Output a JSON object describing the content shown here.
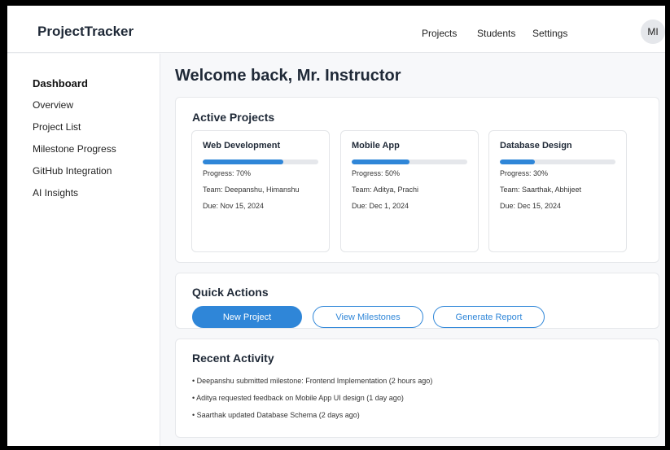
{
  "app": {
    "brand": "ProjectTracker"
  },
  "header": {
    "nav": [
      "Projects",
      "Students",
      "Settings"
    ],
    "avatar": "MI"
  },
  "sidebar": {
    "items": [
      {
        "label": "Dashboard",
        "active": true
      },
      {
        "label": "Overview"
      },
      {
        "label": "Project List"
      },
      {
        "label": "Milestone Progress"
      },
      {
        "label": "GitHub Integration"
      },
      {
        "label": "AI Insights"
      }
    ]
  },
  "main": {
    "title": "Welcome back, Mr. Instructor",
    "active_projects": {
      "title": "Active Projects",
      "projects": [
        {
          "name": "Web Development",
          "progress": 70,
          "progress_label": "Progress: 70%",
          "team": "Team: Deepanshu, Himanshu",
          "due": "Due: Nov 15, 2024"
        },
        {
          "name": "Mobile App",
          "progress": 50,
          "progress_label": "Progress: 50%",
          "team": "Team: Aditya, Prachi",
          "due": "Due: Dec 1, 2024"
        },
        {
          "name": "Database Design",
          "progress": 30,
          "progress_label": "Progress: 30%",
          "team": "Team: Saarthak, Abhijeet",
          "due": "Due: Dec 15, 2024"
        }
      ]
    },
    "quick_actions": {
      "title": "Quick Actions",
      "buttons": [
        "New Project",
        "View Milestones",
        "Generate Report"
      ]
    },
    "recent_activity": {
      "title": "Recent Activity",
      "items": [
        "• Deepanshu submitted milestone: Frontend Implementation (2 hours ago)",
        "• Aditya requested feedback on Mobile App UI design (1 day ago)",
        "• Saarthak updated Database Schema (2 days ago)"
      ]
    }
  },
  "colors": {
    "accent": "#2f86d8",
    "track": "#e5e7eb",
    "background": "#f7f8fa"
  }
}
